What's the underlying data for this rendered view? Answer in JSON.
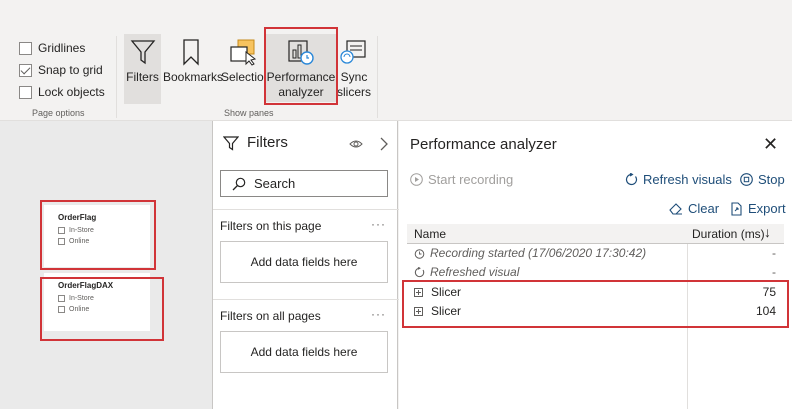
{
  "ribbon": {
    "page_options": {
      "items": [
        {
          "label": "Gridlines",
          "checked": false
        },
        {
          "label": "Snap to grid",
          "checked": true
        },
        {
          "label": "Lock objects",
          "checked": false
        }
      ],
      "group_label": "Page options"
    },
    "show_panes": {
      "group_label": "Show panes",
      "buttons": [
        {
          "label": "Filters",
          "icon": "filter-icon"
        },
        {
          "label": "Bookmarks",
          "icon": "bookmark-icon"
        },
        {
          "label": "Selection",
          "icon": "selection-icon"
        },
        {
          "label_line1": "Performance",
          "label_line2": "analyzer",
          "icon": "performance-analyzer-icon"
        },
        {
          "label_line1": "Sync",
          "label_line2": "slicers",
          "icon": "sync-slicers-icon"
        }
      ]
    }
  },
  "canvas": {
    "slicers": [
      {
        "title": "OrderFlag",
        "options": [
          "In-Store",
          "Online"
        ]
      },
      {
        "title": "OrderFlagDAX",
        "options": [
          "In-Store",
          "Online"
        ]
      }
    ]
  },
  "filters_pane": {
    "title": "Filters",
    "search_placeholder": "Search",
    "sections": [
      {
        "label": "Filters on this page",
        "drop_text": "Add data fields here",
        "menu": "···"
      },
      {
        "label": "Filters on all pages",
        "drop_text": "Add data fields here",
        "menu": "···"
      }
    ]
  },
  "performance_analyzer": {
    "title": "Performance analyzer",
    "close": "✕",
    "start_recording": "Start recording",
    "refresh_visuals": "Refresh visuals",
    "stop": "Stop",
    "clear": "Clear",
    "export": "Export",
    "columns": {
      "name": "Name",
      "duration": "Duration (ms)"
    },
    "rows": [
      {
        "name": "Recording started (17/06/2020 17:30:42)",
        "duration": "-",
        "type": "log"
      },
      {
        "name": "Refreshed visual",
        "duration": "-",
        "type": "log"
      },
      {
        "name": "Slicer",
        "duration": "75",
        "type": "visual"
      },
      {
        "name": "Slicer",
        "duration": "104",
        "type": "visual"
      }
    ]
  },
  "colors": {
    "highlight": "#d13438",
    "link": "#1f4e79",
    "pane_bg": "#f3f2f1"
  }
}
